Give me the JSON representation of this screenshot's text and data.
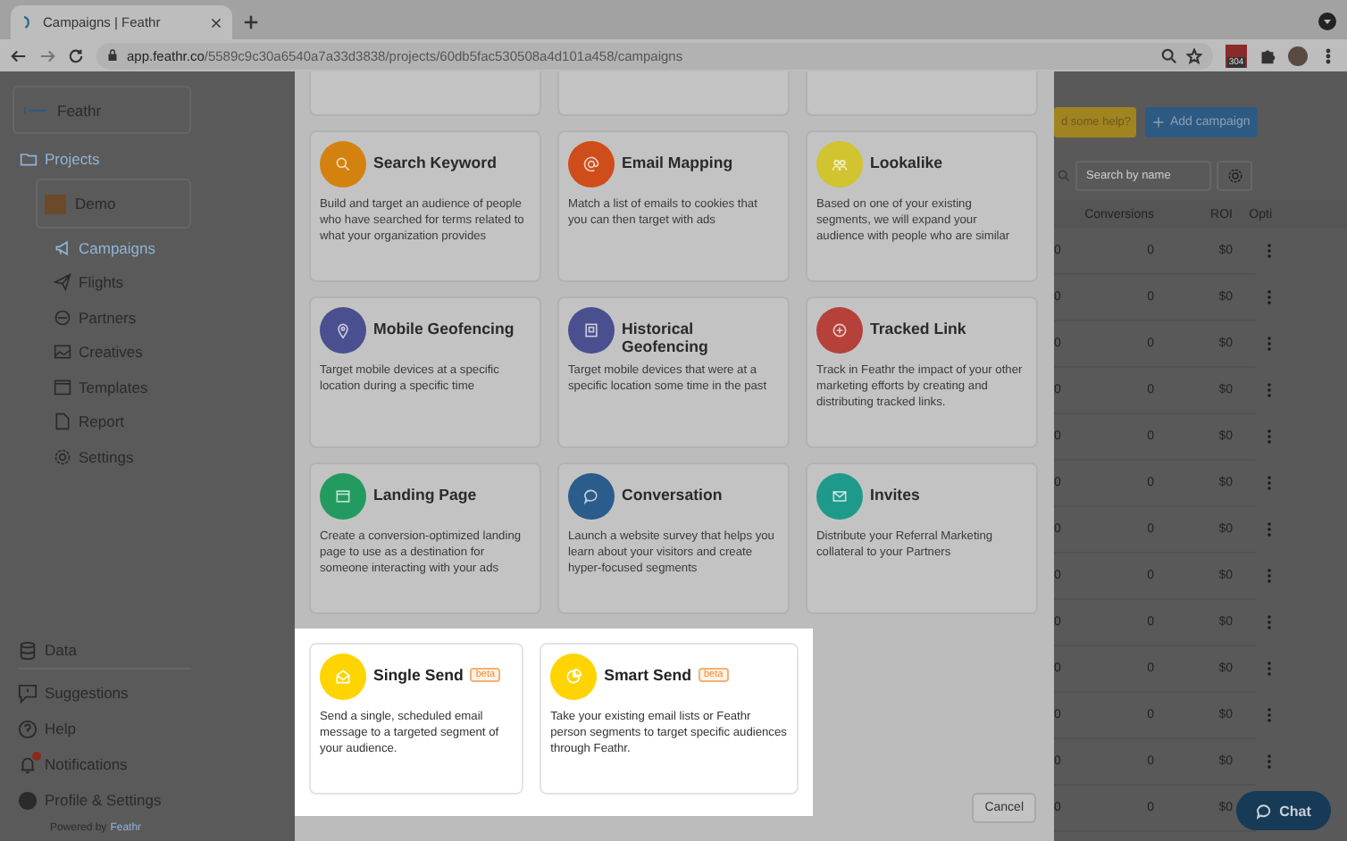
{
  "browser": {
    "tab_title": "Campaigns | Feathr",
    "url_host": "app.feathr.co",
    "url_path": "/5589c9c30a6540a7a33d3838/projects/60db5fac530508a4d101a458/campaigns",
    "extension_badge": "304"
  },
  "sidebar": {
    "brand": "Feathr",
    "section": "Projects",
    "project": "Demo",
    "items": [
      {
        "label": "Campaigns",
        "selected": true
      },
      {
        "label": "Flights",
        "selected": false
      },
      {
        "label": "Partners",
        "selected": false
      },
      {
        "label": "Creatives",
        "selected": false
      },
      {
        "label": "Templates",
        "selected": false
      },
      {
        "label": "Report",
        "selected": false
      },
      {
        "label": "Settings",
        "selected": false
      }
    ],
    "bottom_items": [
      {
        "label": "Data",
        "alert": false
      },
      {
        "label": "Suggestions",
        "alert": false
      },
      {
        "label": "Help",
        "alert": false
      },
      {
        "label": "Notifications",
        "alert": true
      },
      {
        "label": "Profile & Settings",
        "alert": false
      }
    ],
    "powered_by": "Powered by",
    "powered_brand": "Feathr"
  },
  "background": {
    "help_button": "d some help?",
    "add_button": "Add campaign",
    "search": {
      "placeholder": "Search by name"
    },
    "columns": [
      "Conversions",
      "ROI",
      "Opti"
    ],
    "rows": [
      {
        "column_1": "0",
        "conversions": "0",
        "roi": "$0"
      },
      {
        "column_1": "0",
        "conversions": "0",
        "roi": "$0"
      },
      {
        "column_1": "0",
        "conversions": "0",
        "roi": "$0"
      },
      {
        "column_1": "0",
        "conversions": "0",
        "roi": "$0"
      },
      {
        "column_1": "0",
        "conversions": "0",
        "roi": "$0"
      },
      {
        "column_1": "0",
        "conversions": "0",
        "roi": "$0"
      },
      {
        "column_1": "0",
        "conversions": "0",
        "roi": "$0"
      },
      {
        "column_1": "0",
        "conversions": "0",
        "roi": "$0"
      },
      {
        "column_1": "0",
        "conversions": "0",
        "roi": "$0"
      },
      {
        "column_1": "0",
        "conversions": "0",
        "roi": "$0"
      },
      {
        "column_1": "0",
        "conversions": "0",
        "roi": "$0"
      },
      {
        "column_1": "0",
        "conversions": "0",
        "roi": "$0"
      },
      {
        "column_1": "0",
        "conversions": "0",
        "roi": "$0"
      }
    ]
  },
  "modal": {
    "cards": [
      {
        "title": "Search Keyword",
        "description": "Build and target an audience of people who have searched for terms related to what your organization provides",
        "color": "#d4820f",
        "beta": false
      },
      {
        "title": "Email Mapping",
        "description": "Match a list of emails to cookies that you can then target with ads",
        "color": "#cf4d1a",
        "beta": false
      },
      {
        "title": "Lookalike",
        "description": "Based on one of your existing segments, we will expand your audience with people who are similar",
        "color": "#d2c330",
        "beta": false
      },
      {
        "title": "Mobile Geofencing",
        "description": "Target mobile devices at a specific location during a specific time",
        "color": "#4a4f8f",
        "beta": false
      },
      {
        "title": "Historical Geofencing",
        "description": "Target mobile devices that were at a specific location some time in the past",
        "color": "#4a4f8f",
        "beta": false
      },
      {
        "title": "Tracked Link",
        "description": "Track in Feathr the impact of your other marketing efforts by creating and distributing tracked links.",
        "color": "#b5413a",
        "beta": false
      },
      {
        "title": "Landing Page",
        "description": "Create a conversion-optimized landing page to use as a destination for someone interacting with your ads",
        "color": "#239a5f",
        "beta": false
      },
      {
        "title": "Conversation",
        "description": "Launch a website survey that helps you learn about your visitors and create hyper-focused segments",
        "color": "#2a5c8c",
        "beta": false
      },
      {
        "title": "Invites",
        "description": "Distribute your Referral Marketing collateral to your Partners",
        "color": "#1e9a8b",
        "beta": false
      }
    ],
    "spotlight_cards": [
      {
        "title": "Single Send",
        "description": "Send a single, scheduled email message to a targeted segment of your audience.",
        "color": "#ffd400",
        "beta": true,
        "badge": "beta"
      },
      {
        "title": "Smart Send",
        "description": "Take your existing email lists or Feathr person segments to target specific audiences through Feathr.",
        "color": "#ffd400",
        "beta": true,
        "badge": "beta"
      }
    ],
    "cancel_button": "Cancel"
  },
  "chat_button": "Chat"
}
